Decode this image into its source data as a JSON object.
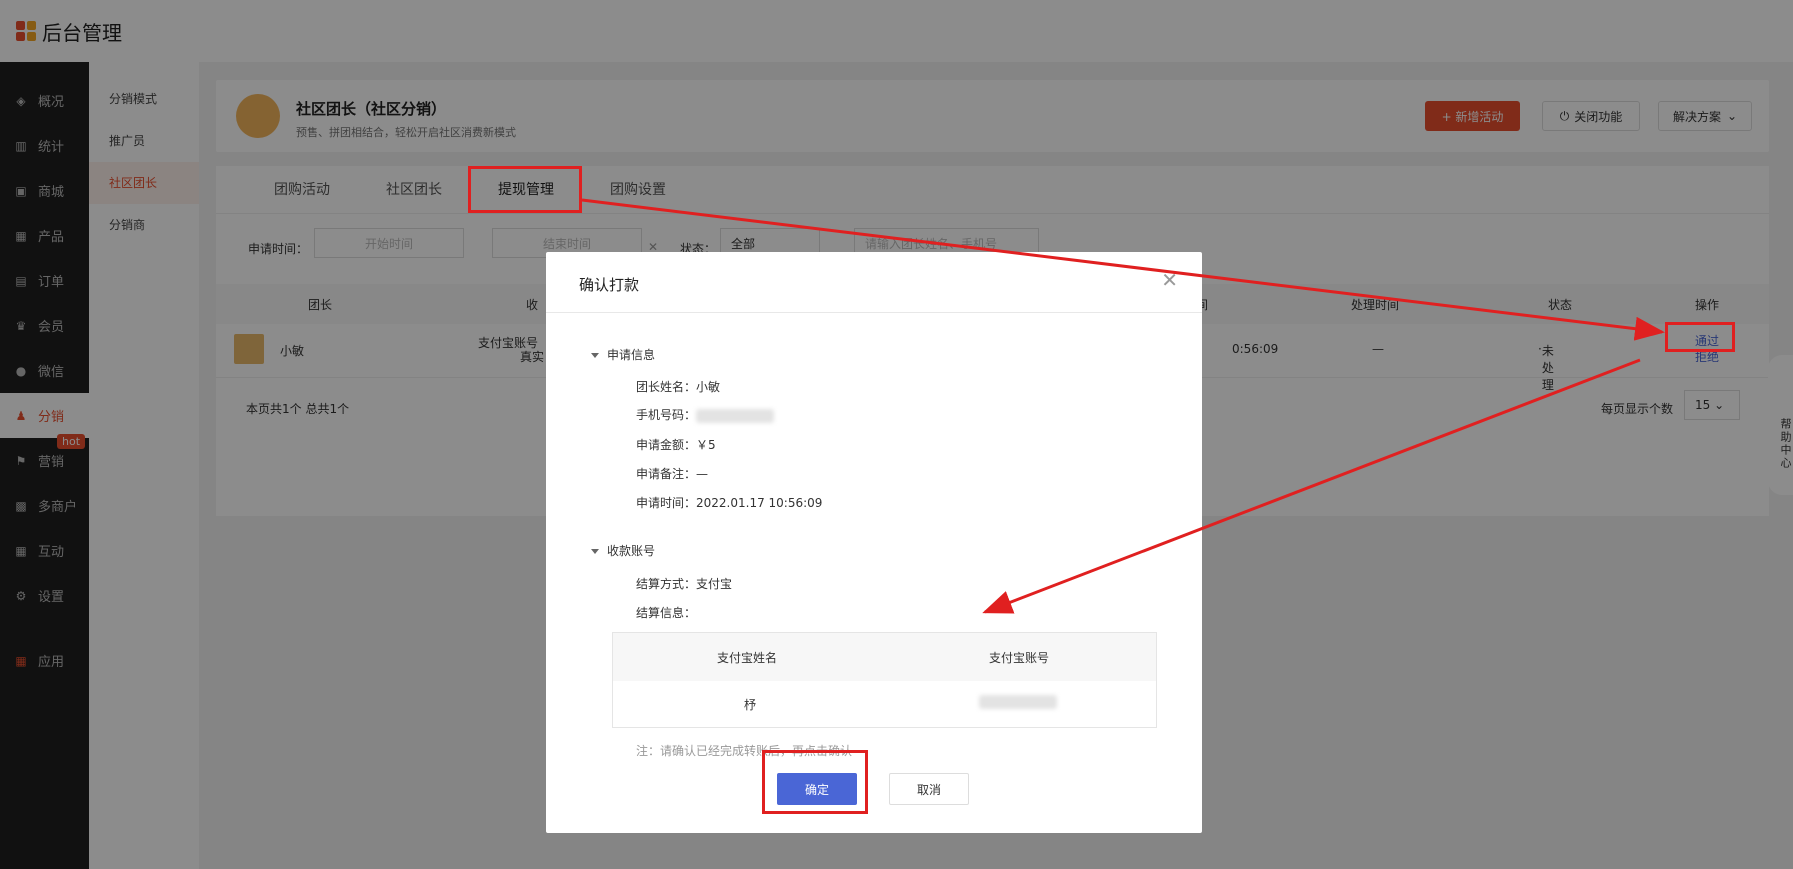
{
  "app": {
    "title": "后台管理"
  },
  "sidebar": {
    "items": [
      {
        "label": "概况",
        "icon": "layers-icon"
      },
      {
        "label": "统计",
        "icon": "chart-icon"
      },
      {
        "label": "商城",
        "icon": "shop-icon"
      },
      {
        "label": "产品",
        "icon": "grid-icon"
      },
      {
        "label": "订单",
        "icon": "order-icon"
      },
      {
        "label": "会员",
        "icon": "crown-icon"
      },
      {
        "label": "微信",
        "icon": "wechat-icon"
      },
      {
        "label": "分销",
        "icon": "users-icon",
        "active": true
      },
      {
        "label": "营销",
        "icon": "flag-icon",
        "badge": "hot"
      },
      {
        "label": "多商户",
        "icon": "store-icon"
      },
      {
        "label": "互动",
        "icon": "grid-icon"
      },
      {
        "label": "设置",
        "icon": "gear-icon"
      },
      {
        "label": "应用",
        "icon": "apps-icon"
      }
    ]
  },
  "subnav": {
    "items": [
      "分销模式",
      "推广员",
      "社区团长",
      "分销商"
    ],
    "active": "社区团长"
  },
  "header": {
    "title": "社区团长（社区分销）",
    "desc": "预售、拼团相结合，轻松开启社区消费新模式",
    "add_label": "+ 新增活动",
    "close_label": "关闭功能",
    "solution_label": "解决方案"
  },
  "tabs": [
    "团购活动",
    "社区团长",
    "提现管理",
    "团购设置"
  ],
  "filters": {
    "date_label": "申请时间：",
    "start_placeholder": "开始时间",
    "end_placeholder": "结束时间",
    "status_label": "状态：",
    "status_value": "全部",
    "search_placeholder": "请输入团长姓名、手机号"
  },
  "table": {
    "headers": [
      "团长",
      "收",
      "间",
      "处理时间",
      "状态",
      "操作"
    ],
    "row": {
      "name": "小敏",
      "account": "支付宝账号",
      "real": "真实",
      "time": "0:56:09",
      "process": "—",
      "status": "未处理",
      "approve": "通过",
      "reject": "拒绝"
    }
  },
  "pager": {
    "summary": "本页共1个  总共1个",
    "per_page_label": "每页显示个数",
    "per_page": "15"
  },
  "modal": {
    "title": "确认打款",
    "section1": "申请信息",
    "leader_name": "团长姓名：小敏",
    "phone_label": "手机号码：",
    "amount": "申请金额：￥5",
    "remark": "申请备注：—",
    "apply_time": "申请时间：2022.01.17 10:56:09",
    "section2": "收款账号",
    "settle_method": "结算方式：支付宝",
    "settle_info": "结算信息：",
    "acct_headers": [
      "支付宝姓名",
      "支付宝账号"
    ],
    "acct_name": "杼",
    "note": "注：请确认已经完成转账后，再点击确认",
    "ok": "确定",
    "cancel": "取消"
  },
  "help": {
    "label": "帮助中心"
  }
}
